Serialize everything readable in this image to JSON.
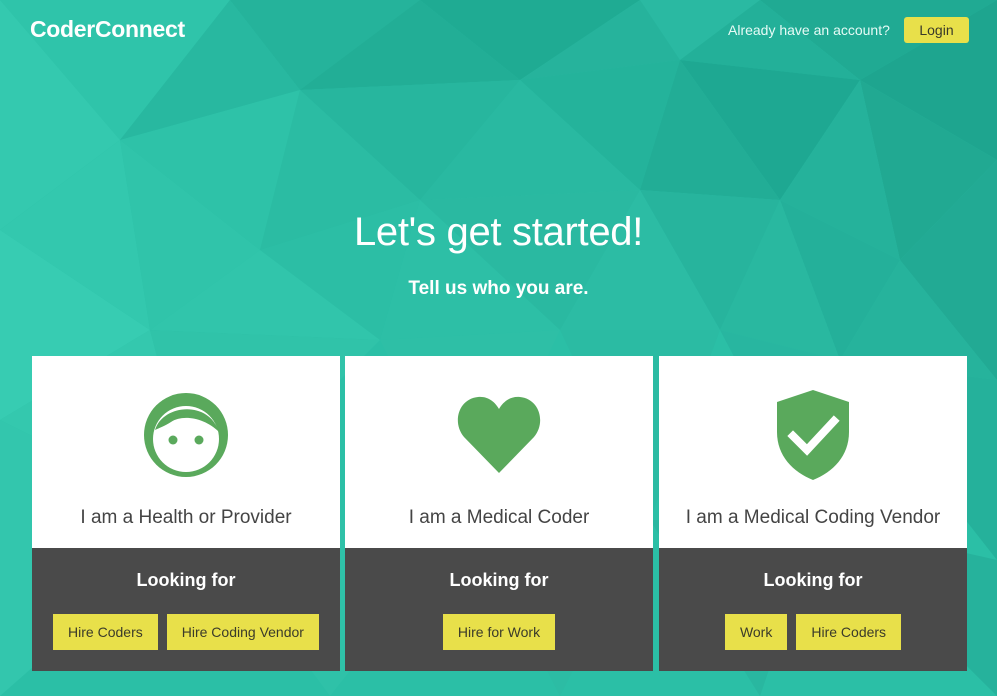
{
  "colors": {
    "background_teal": "#2bbfa6",
    "accent_yellow": "#e8e04a",
    "icon_green": "#5aa95c",
    "card_dark": "#4a4a4a"
  },
  "header": {
    "brand": "CoderConnect",
    "account_prompt": "Already have an account?",
    "login_label": "Login"
  },
  "hero": {
    "title": "Let's get started!",
    "subtitle": "Tell us who you are."
  },
  "cards": [
    {
      "icon": "face-icon",
      "title": "I am a Health or Provider",
      "looking_for": "Looking for",
      "buttons": [
        "Hire Coders",
        "Hire Coding Vendor"
      ]
    },
    {
      "icon": "heart-icon",
      "title": "I am a Medical Coder",
      "looking_for": "Looking for",
      "buttons": [
        "Hire for Work"
      ]
    },
    {
      "icon": "shield-check-icon",
      "title": "I am a Medical Coding Vendor",
      "looking_for": "Looking for",
      "buttons": [
        "Work",
        "Hire Coders"
      ]
    }
  ]
}
